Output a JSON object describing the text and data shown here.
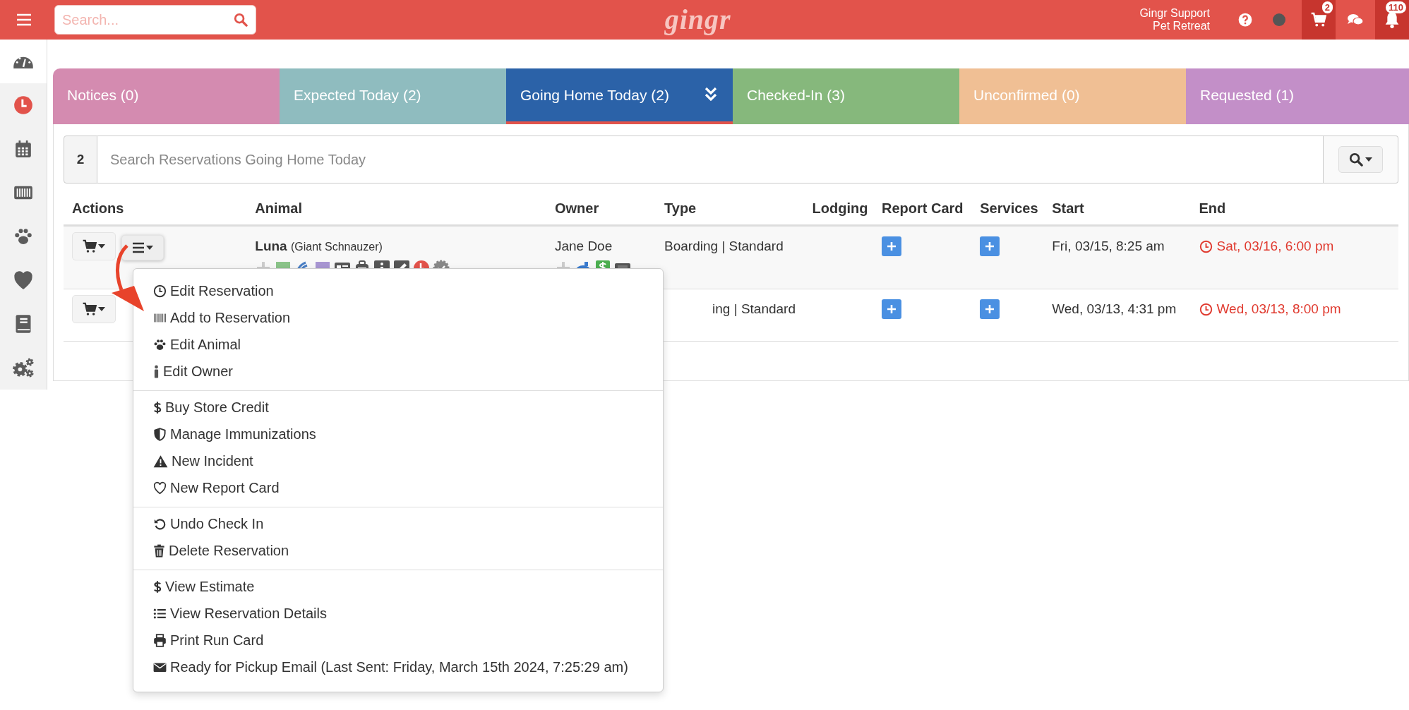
{
  "topbar": {
    "search": {
      "placeholder": "Search..."
    },
    "logo": "gingr",
    "user": {
      "name": "Gingr Support",
      "location": "Pet Retreat"
    },
    "cart_count": "2",
    "notification_count": "110"
  },
  "sidebar": {
    "items": [
      {
        "selected": true
      },
      {
        "selected": false
      },
      {
        "selected": false
      },
      {
        "selected": false
      },
      {
        "selected": false
      },
      {
        "selected": false
      },
      {
        "selected": false
      },
      {
        "selected": false
      }
    ]
  },
  "tabs": [
    {
      "label": "Notices (0)",
      "selected": false,
      "color": "#d48bb0"
    },
    {
      "label": "Expected Today (2)",
      "selected": false,
      "color": "#8fbcbf"
    },
    {
      "label": "Going Home Today (2)",
      "selected": true,
      "color": "#2b62a8"
    },
    {
      "label": "Checked-In (3)",
      "selected": false,
      "color": "#86b87c"
    },
    {
      "label": "Unconfirmed (0)",
      "selected": false,
      "color": "#f0bf94"
    },
    {
      "label": "Requested (1)",
      "selected": false,
      "color": "#c38fc8"
    }
  ],
  "search": {
    "count": "2",
    "placeholder": "Search Reservations Going Home Today"
  },
  "table": {
    "columns": [
      "Actions",
      "Animal",
      "Owner",
      "Type",
      "Lodging",
      "Report Card",
      "Services",
      "Start",
      "End"
    ],
    "rows": [
      {
        "buttons": [
          {
            "kind": "cart"
          },
          {
            "kind": "menu",
            "open": true
          }
        ],
        "animal": "Luna",
        "breed": "(Giant Schnauzer)",
        "owner": "Jane Doe",
        "type": "Boarding | Standard",
        "start": "Fri, 03/15, 8:25 am",
        "end": "Sat, 03/16, 6:00 pm"
      },
      {
        "buttons": [
          {
            "kind": "cart"
          }
        ],
        "type": "ing | Standard",
        "start": "Wed, 03/13, 4:31 pm",
        "end": "Wed, 03/13, 8:00 pm"
      }
    ]
  },
  "menu": {
    "sections": [
      [
        "Edit Reservation",
        "Add to Reservation",
        "Edit Animal",
        "Edit Owner"
      ],
      [
        "Buy Store Credit",
        "Manage Immunizations",
        "New Incident",
        "New Report Card"
      ],
      [
        "Undo Check In",
        "Delete Reservation"
      ],
      [
        "View Estimate",
        "View Reservation Details",
        "Print Run Card",
        "Ready for Pickup Email (Last Sent: Friday, March 15th 2024, 7:25:29 am)"
      ]
    ]
  }
}
